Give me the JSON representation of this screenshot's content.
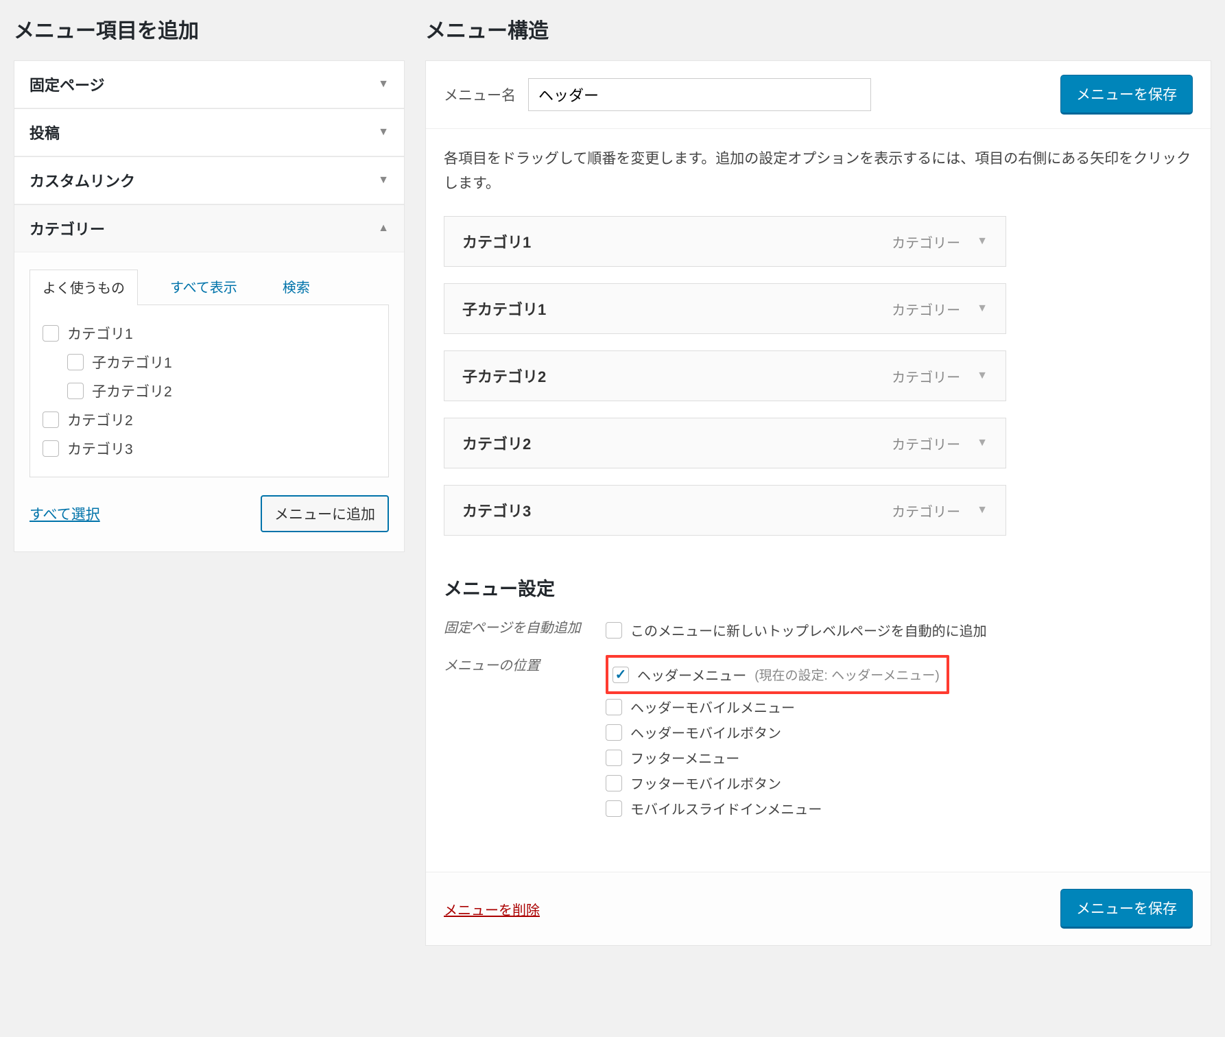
{
  "left": {
    "title": "メニュー項目を追加",
    "accordions": [
      {
        "label": "固定ページ",
        "open": false
      },
      {
        "label": "投稿",
        "open": false
      },
      {
        "label": "カスタムリンク",
        "open": false
      },
      {
        "label": "カテゴリー",
        "open": true
      }
    ],
    "tabs": {
      "frequent": "よく使うもの",
      "view_all": "すべて表示",
      "search": "検索"
    },
    "categories": [
      {
        "label": "カテゴリ1",
        "indent": false
      },
      {
        "label": "子カテゴリ1",
        "indent": true
      },
      {
        "label": "子カテゴリ2",
        "indent": true
      },
      {
        "label": "カテゴリ2",
        "indent": false
      },
      {
        "label": "カテゴリ3",
        "indent": false
      }
    ],
    "select_all": "すべて選択",
    "add_to_menu": "メニューに追加"
  },
  "right": {
    "title": "メニュー構造",
    "name_label": "メニュー名",
    "name_value": "ヘッダー",
    "save_button": "メニューを保存",
    "instruction": "各項目をドラッグして順番を変更します。追加の設定オプションを表示するには、項目の右側にある矢印をクリックします。",
    "type_label": "カテゴリー",
    "items": [
      {
        "label": "カテゴリ1"
      },
      {
        "label": "子カテゴリ1"
      },
      {
        "label": "子カテゴリ2"
      },
      {
        "label": "カテゴリ2"
      },
      {
        "label": "カテゴリ3"
      }
    ],
    "settings_title": "メニュー設定",
    "auto_add_label": "固定ページを自動追加",
    "auto_add_text": "このメニューに新しいトップレベルページを自動的に追加",
    "location_label": "メニューの位置",
    "locations": [
      {
        "label": "ヘッダーメニュー",
        "checked": true,
        "note": "(現在の設定: ヘッダーメニュー)"
      },
      {
        "label": "ヘッダーモバイルメニュー",
        "checked": false,
        "note": ""
      },
      {
        "label": "ヘッダーモバイルボタン",
        "checked": false,
        "note": ""
      },
      {
        "label": "フッターメニュー",
        "checked": false,
        "note": ""
      },
      {
        "label": "フッターモバイルボタン",
        "checked": false,
        "note": ""
      },
      {
        "label": "モバイルスライドインメニュー",
        "checked": false,
        "note": ""
      }
    ],
    "delete_menu": "メニューを削除",
    "save_button_footer": "メニューを保存"
  }
}
